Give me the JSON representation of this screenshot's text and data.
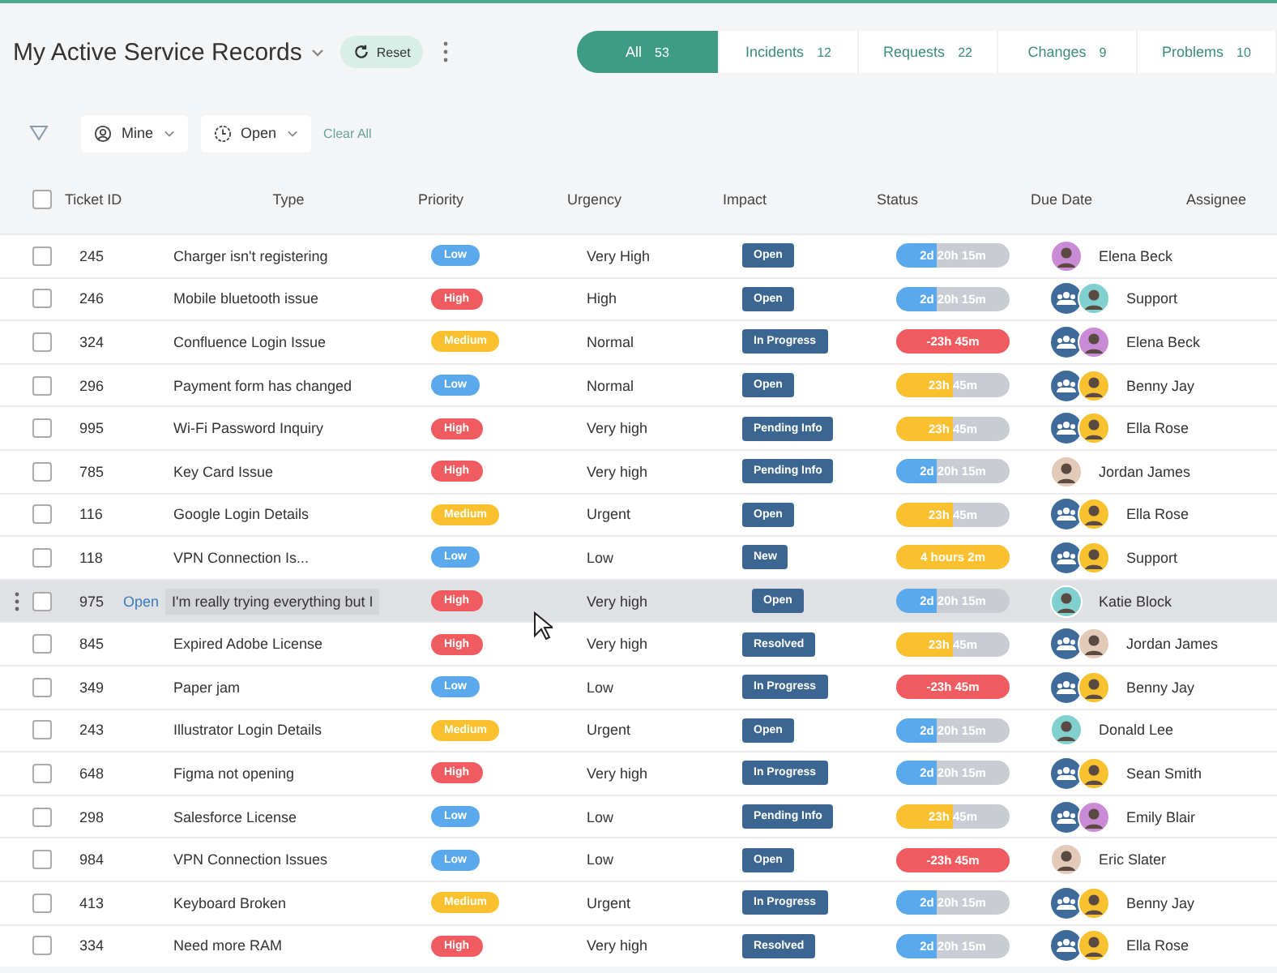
{
  "header": {
    "title": "My Active Service Records",
    "reset": "Reset"
  },
  "tabs": [
    {
      "label": "All",
      "count": "53",
      "selected": true
    },
    {
      "label": "Incidents",
      "count": "12",
      "selected": false
    },
    {
      "label": "Requests",
      "count": "22",
      "selected": false
    },
    {
      "label": "Changes",
      "count": "9",
      "selected": false
    },
    {
      "label": "Problems",
      "count": "10",
      "selected": false
    }
  ],
  "filters": {
    "chips": [
      {
        "label": "Mine",
        "kind": "person"
      },
      {
        "label": "Open",
        "kind": "clock"
      }
    ],
    "clear": "Clear All"
  },
  "select_all": {
    "checked": false
  },
  "columns": [
    "Ticket ID",
    "Type",
    "Priority",
    "Urgency",
    "Impact",
    "Status",
    "Due Date",
    "Assignee"
  ],
  "rows": [
    {
      "id": "245",
      "type": "Charger isn't registering",
      "priority": {
        "label": "Low",
        "color": "#5aa9ec"
      },
      "urgency": "Very High",
      "impact": "Open",
      "due": {
        "text": "2d 20h 15m",
        "level": 0.35,
        "color": "#5aa9ec"
      },
      "assignee": {
        "name": "Elena Beck",
        "team": false,
        "color": "#c98bd6"
      },
      "checked": false,
      "hovered": false
    },
    {
      "id": "246",
      "type": "Mobile bluetooth issue",
      "priority": {
        "label": "High",
        "color": "#ef5b5e"
      },
      "urgency": "High",
      "impact": "Open",
      "due": {
        "text": "2d 20h 15m",
        "level": 0.35,
        "color": "#5aa9ec"
      },
      "assignee": {
        "name": "Support",
        "team": true,
        "color": "#7fd0cf"
      },
      "checked": false,
      "hovered": false
    },
    {
      "id": "324",
      "type": "Confluence Login Issue",
      "priority": {
        "label": "Medium",
        "color": "#fbc02d"
      },
      "urgency": "Normal",
      "impact": "In Progress",
      "due": {
        "text": "-23h 45m",
        "level": 1,
        "color": "#ef5b5e"
      },
      "assignee": {
        "name": "Elena Beck",
        "team": true,
        "color": "#c98bd6"
      },
      "checked": false,
      "hovered": false
    },
    {
      "id": "296",
      "type": "Payment form has changed",
      "priority": {
        "label": "Low",
        "color": "#5aa9ec"
      },
      "urgency": "Normal",
      "impact": "Open",
      "due": {
        "text": "23h 45m",
        "level": 0.5,
        "color": "#fbc02d"
      },
      "assignee": {
        "name": "Benny Jay",
        "team": true,
        "color": "#f7c12f"
      },
      "checked": false,
      "hovered": false
    },
    {
      "id": "995",
      "type": "Wi-Fi Password Inquiry",
      "priority": {
        "label": "High",
        "color": "#ef5b5e"
      },
      "urgency": "Very high",
      "impact": "Pending Info",
      "due": {
        "text": "23h 45m",
        "level": 0.5,
        "color": "#fbc02d"
      },
      "assignee": {
        "name": "Ella Rose",
        "team": true,
        "color": "#f7c12f"
      },
      "checked": false,
      "hovered": false
    },
    {
      "id": "785",
      "type": "Key Card Issue",
      "priority": {
        "label": "High",
        "color": "#ef5b5e"
      },
      "urgency": "Very high",
      "impact": "Pending Info",
      "due": {
        "text": "2d 20h 15m",
        "level": 0.35,
        "color": "#5aa9ec"
      },
      "assignee": {
        "name": "Jordan James",
        "team": false,
        "color": "#e2c9b8"
      },
      "checked": false,
      "hovered": false
    },
    {
      "id": "116",
      "type": "Google Login Details",
      "priority": {
        "label": "Medium",
        "color": "#fbc02d"
      },
      "urgency": "Urgent",
      "impact": "Open",
      "due": {
        "text": "23h 45m",
        "level": 0.5,
        "color": "#fbc02d"
      },
      "assignee": {
        "name": "Ella Rose",
        "team": true,
        "color": "#f7c12f"
      },
      "checked": false,
      "hovered": false
    },
    {
      "id": "118",
      "type": "VPN Connection Is...",
      "priority": {
        "label": "Low",
        "color": "#5aa9ec"
      },
      "urgency": "Low",
      "impact": "New",
      "due": {
        "text": "4 hours 2m",
        "level": 1,
        "color": "#fbc02d"
      },
      "assignee": {
        "name": "Support",
        "team": true,
        "color": "#f7c12f"
      },
      "checked": false,
      "hovered": false
    },
    {
      "id": "975",
      "open": "Open",
      "type": "I'm really trying everything but I",
      "priority": {
        "label": "High",
        "color": "#ef5b5e"
      },
      "urgency": "Very high",
      "impact": "Open",
      "due": {
        "text": "2d 20h 15m",
        "level": 0.35,
        "color": "#5aa9ec"
      },
      "assignee": {
        "name": "Katie Block",
        "team": false,
        "color": "#7fd0cf"
      },
      "checked": false,
      "hovered": true
    },
    {
      "id": "845",
      "type": "Expired Adobe License",
      "priority": {
        "label": "High",
        "color": "#ef5b5e"
      },
      "urgency": "Very high",
      "impact": "Resolved",
      "due": {
        "text": "23h 45m",
        "level": 0.5,
        "color": "#fbc02d"
      },
      "assignee": {
        "name": "Jordan James",
        "team": true,
        "color": "#e2c9b8"
      },
      "checked": false,
      "hovered": false
    },
    {
      "id": "349",
      "type": "Paper jam",
      "priority": {
        "label": "Low",
        "color": "#5aa9ec"
      },
      "urgency": "Low",
      "impact": "In Progress",
      "due": {
        "text": "-23h 45m",
        "level": 1,
        "color": "#ef5b5e"
      },
      "assignee": {
        "name": "Benny Jay",
        "team": true,
        "color": "#f7c12f"
      },
      "checked": false,
      "hovered": false
    },
    {
      "id": "243",
      "type": "Illustrator Login Details",
      "priority": {
        "label": "Medium",
        "color": "#fbc02d"
      },
      "urgency": "Urgent",
      "impact": "Open",
      "due": {
        "text": "2d 20h 15m",
        "level": 0.35,
        "color": "#5aa9ec"
      },
      "assignee": {
        "name": "Donald Lee",
        "team": false,
        "color": "#7fd0cf"
      },
      "checked": false,
      "hovered": false
    },
    {
      "id": "648",
      "type": "Figma not opening",
      "priority": {
        "label": "High",
        "color": "#ef5b5e"
      },
      "urgency": "Very high",
      "impact": "In Progress",
      "due": {
        "text": "2d 20h 15m",
        "level": 0.35,
        "color": "#5aa9ec"
      },
      "assignee": {
        "name": "Sean Smith",
        "team": true,
        "color": "#f7c12f"
      },
      "checked": false,
      "hovered": false
    },
    {
      "id": "298",
      "type": "Salesforce License",
      "priority": {
        "label": "Low",
        "color": "#5aa9ec"
      },
      "urgency": "Low",
      "impact": "Pending Info",
      "due": {
        "text": "23h 45m",
        "level": 0.5,
        "color": "#fbc02d"
      },
      "assignee": {
        "name": "Emily Blair",
        "team": true,
        "color": "#c98bd6"
      },
      "checked": false,
      "hovered": false
    },
    {
      "id": "984",
      "type": "VPN Connection Issues",
      "priority": {
        "label": "Low",
        "color": "#5aa9ec"
      },
      "urgency": "Low",
      "impact": "Open",
      "due": {
        "text": "-23h 45m",
        "level": 1,
        "color": "#ef5b5e"
      },
      "assignee": {
        "name": "Eric Slater",
        "team": false,
        "color": "#e2c9b8"
      },
      "checked": false,
      "hovered": false
    },
    {
      "id": "413",
      "type": "Keyboard Broken",
      "priority": {
        "label": "Medium",
        "color": "#fbc02d"
      },
      "urgency": "Urgent",
      "impact": "In Progress",
      "due": {
        "text": "2d 20h 15m",
        "level": 0.35,
        "color": "#5aa9ec"
      },
      "assignee": {
        "name": "Benny Jay",
        "team": true,
        "color": "#f7c12f"
      },
      "checked": false,
      "hovered": false
    },
    {
      "id": "334",
      "type": "Need more RAM",
      "priority": {
        "label": "High",
        "color": "#ef5b5e"
      },
      "urgency": "Very high",
      "impact": "Resolved",
      "due": {
        "text": "2d 20h 15m",
        "level": 0.35,
        "color": "#5aa9ec"
      },
      "assignee": {
        "name": "Ella Rose",
        "team": true,
        "color": "#f7c12f"
      },
      "checked": false,
      "hovered": false
    }
  ]
}
